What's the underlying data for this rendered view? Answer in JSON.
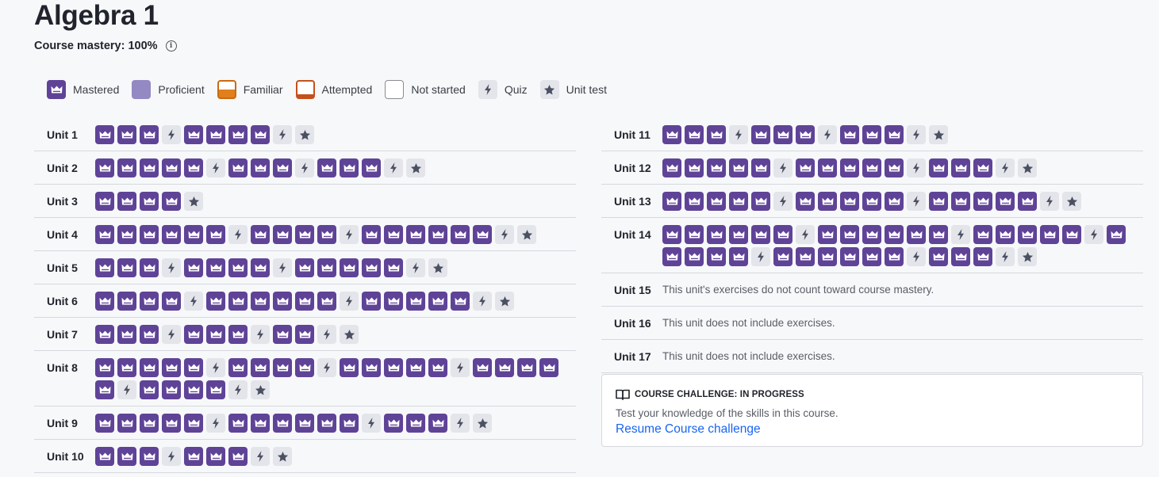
{
  "course": {
    "title": "Algebra 1",
    "mastery_label": "Course mastery: 100%",
    "info_icon": "info-icon"
  },
  "legend": [
    {
      "type": "mastered",
      "label": "Mastered"
    },
    {
      "type": "proficient",
      "label": "Proficient"
    },
    {
      "type": "familiar",
      "label": "Familiar"
    },
    {
      "type": "attempted",
      "label": "Attempted"
    },
    {
      "type": "notstarted",
      "label": "Not started"
    },
    {
      "type": "quiz",
      "label": "Quiz"
    },
    {
      "type": "unittest",
      "label": "Unit test"
    }
  ],
  "colors": {
    "mastered": "#5f4397",
    "proficient": "#9489c3",
    "familiar": "#e07f1b",
    "attempted": "#c4511b",
    "link": "#1865f2"
  },
  "units_left": [
    {
      "label": "Unit 1",
      "skills": "MMMQMMMMQT"
    },
    {
      "label": "Unit 2",
      "skills": "MMMMMQMMMQMMMQT"
    },
    {
      "label": "Unit 3",
      "skills": "MMMMT"
    },
    {
      "label": "Unit 4",
      "skills": "MMMMMMQMMMMQMMMMMMQT"
    },
    {
      "label": "Unit 5",
      "skills": "MMMQMMMMQMMMMMQT"
    },
    {
      "label": "Unit 6",
      "skills": "MMMMQMMMMMMQMMMMMQT"
    },
    {
      "label": "Unit 7",
      "skills": "MMMQMMMQMMQT"
    },
    {
      "label": "Unit 8",
      "skills": "MMMMMQMMMMQMMMMMQMMMMMQMMMMQT"
    },
    {
      "label": "Unit 9",
      "skills": "MMMMMQMMMMMMQMMMQT"
    },
    {
      "label": "Unit 10",
      "skills": "MMMQMMMQT"
    }
  ],
  "units_right": [
    {
      "label": "Unit 11",
      "skills": "MMMQMMMQMMMQT"
    },
    {
      "label": "Unit 12",
      "skills": "MMMMMQMMMMMQMMMQT"
    },
    {
      "label": "Unit 13",
      "skills": "MMMMMQMMMMMQMMMMMQT"
    },
    {
      "label": "Unit 14",
      "skills": "MMMMMMQMMMMMMQMMMMMQMMMMMQMMMMMMQMMMQT"
    },
    {
      "label": "Unit 15",
      "note": "This unit's exercises do not count toward course mastery."
    },
    {
      "label": "Unit 16",
      "note": "This unit does not include exercises."
    },
    {
      "label": "Unit 17",
      "note": "This unit does not include exercises."
    }
  ],
  "challenge": {
    "heading": "COURSE CHALLENGE: IN PROGRESS",
    "description": "Test your knowledge of the skills in this course.",
    "link_label": "Resume Course challenge"
  }
}
